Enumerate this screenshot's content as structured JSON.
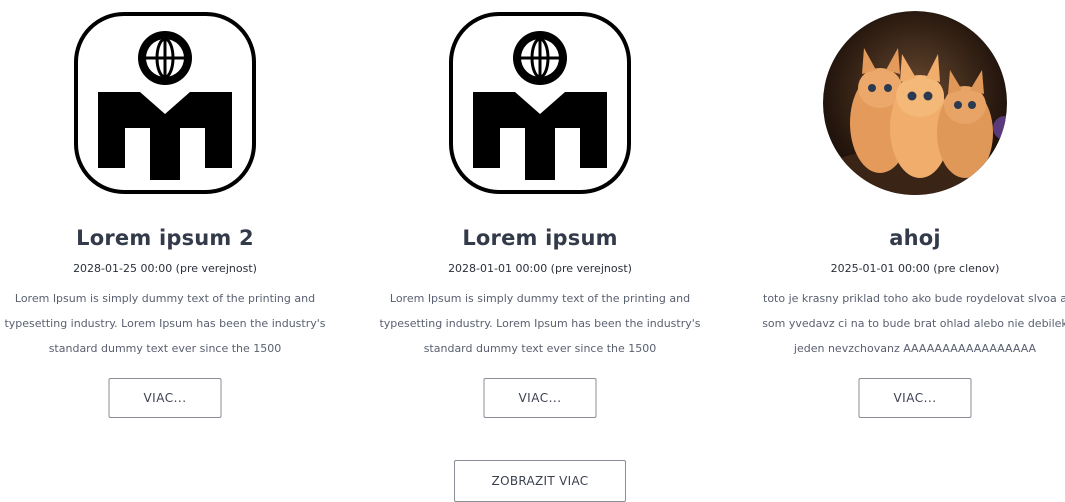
{
  "cards": [
    {
      "image": "mensa-logo",
      "title": "Lorem ipsum 2",
      "meta": "2028-01-25 00:00 (pre verejnost)",
      "desc_lines": [
        "Lorem Ipsum is simply dummy text of the printing and",
        "typesetting industry. Lorem Ipsum has been the industry's",
        "standard dummy text ever since the 1500"
      ],
      "button": "VIAC..."
    },
    {
      "image": "mensa-logo",
      "title": "Lorem ipsum",
      "meta": "2028-01-01 00:00 (pre verejnost)",
      "desc_lines": [
        "Lorem Ipsum is simply dummy text of the printing and",
        "typesetting industry. Lorem Ipsum has been the industry's",
        "standard dummy text ever since the 1500"
      ],
      "button": "VIAC..."
    },
    {
      "image": "kittens-photo",
      "title": "ahoj",
      "meta": "2025-01-01 00:00 (pre clenov)",
      "desc_lines": [
        "toto je krasny priklad toho ako bude roydelovat slvoa a",
        "som yvedavz ci na to bude brat ohlad alebo nie debilek",
        "jeden nevzchovanz AAAAAAAAAAAAAAAAA"
      ],
      "button": "VIAC..."
    }
  ],
  "show_more_label": "ZOBRAZIT VIAC"
}
